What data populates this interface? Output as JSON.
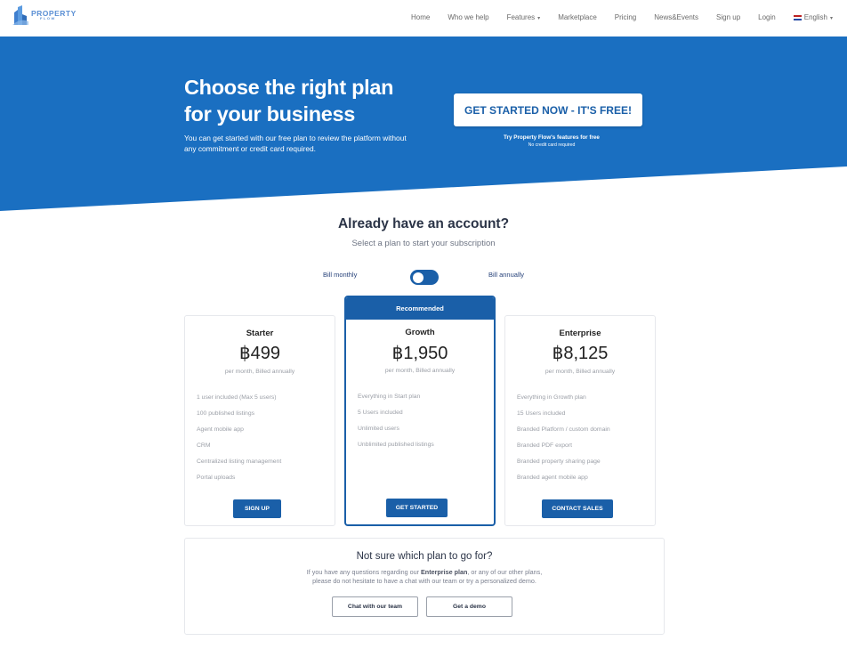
{
  "nav": {
    "logo_main": "PROPERTY",
    "logo_sub": "FLOW",
    "links": [
      "Home",
      "Who we help",
      "Features",
      "Marketplace",
      "Pricing",
      "News&Events",
      "Sign up",
      "Login"
    ],
    "language": "English"
  },
  "hero": {
    "title": "Choose the right plan for your business",
    "subtitle": "You can get started with our free plan to review the platform without any commitment or credit card required.",
    "cta_label": "GET STARTED NOW - IT'S FREE!",
    "cta_note": "Try Property Flow's features for free",
    "cta_note2": "No credit card required"
  },
  "account": {
    "title": "Already have an account?",
    "subtitle": "Select a plan to start your subscription",
    "bill_monthly": "Bill monthly",
    "bill_annually": "Bill annually"
  },
  "plans": [
    {
      "name": "Starter",
      "price": "฿499",
      "period": "per month, Billed annually",
      "features": [
        "1 user included (Max 5 users)",
        "100 published listings",
        "Agent mobile app",
        "CRM",
        "Centralized listing management",
        "Portal uploads"
      ],
      "button": "SIGN UP"
    },
    {
      "badge": "Recommended",
      "name": "Growth",
      "price": "฿1,950",
      "period": "per month, Billed annually",
      "features": [
        "Everything in Start plan",
        "5 Users included",
        "Unlimited users",
        "Unblimited published listings"
      ],
      "button": "GET STARTED"
    },
    {
      "name": "Enterprise",
      "price": "฿8,125",
      "period": "per month, Billed annually",
      "features": [
        "Everything in Growth plan",
        "15 Users included",
        "Branded Platform / custom domain",
        "Branded PDF export",
        "Branded property sharing page",
        "Branded agent mobile app"
      ],
      "button": "CONTACT SALES"
    }
  ],
  "help": {
    "title": "Not sure which plan to go for?",
    "line1_before": "If you have any questions regarding our ",
    "line1_bold": "Enterprise plan",
    "line1_after": ", or any of our other plans,",
    "line2": "please do not hesitate to have a chat with our team or try a personalized demo.",
    "chat_button": "Chat with our team",
    "demo_button": "Get a demo"
  },
  "colors": {
    "brand": "#1a6fc1",
    "button": "#1a5fa8"
  }
}
